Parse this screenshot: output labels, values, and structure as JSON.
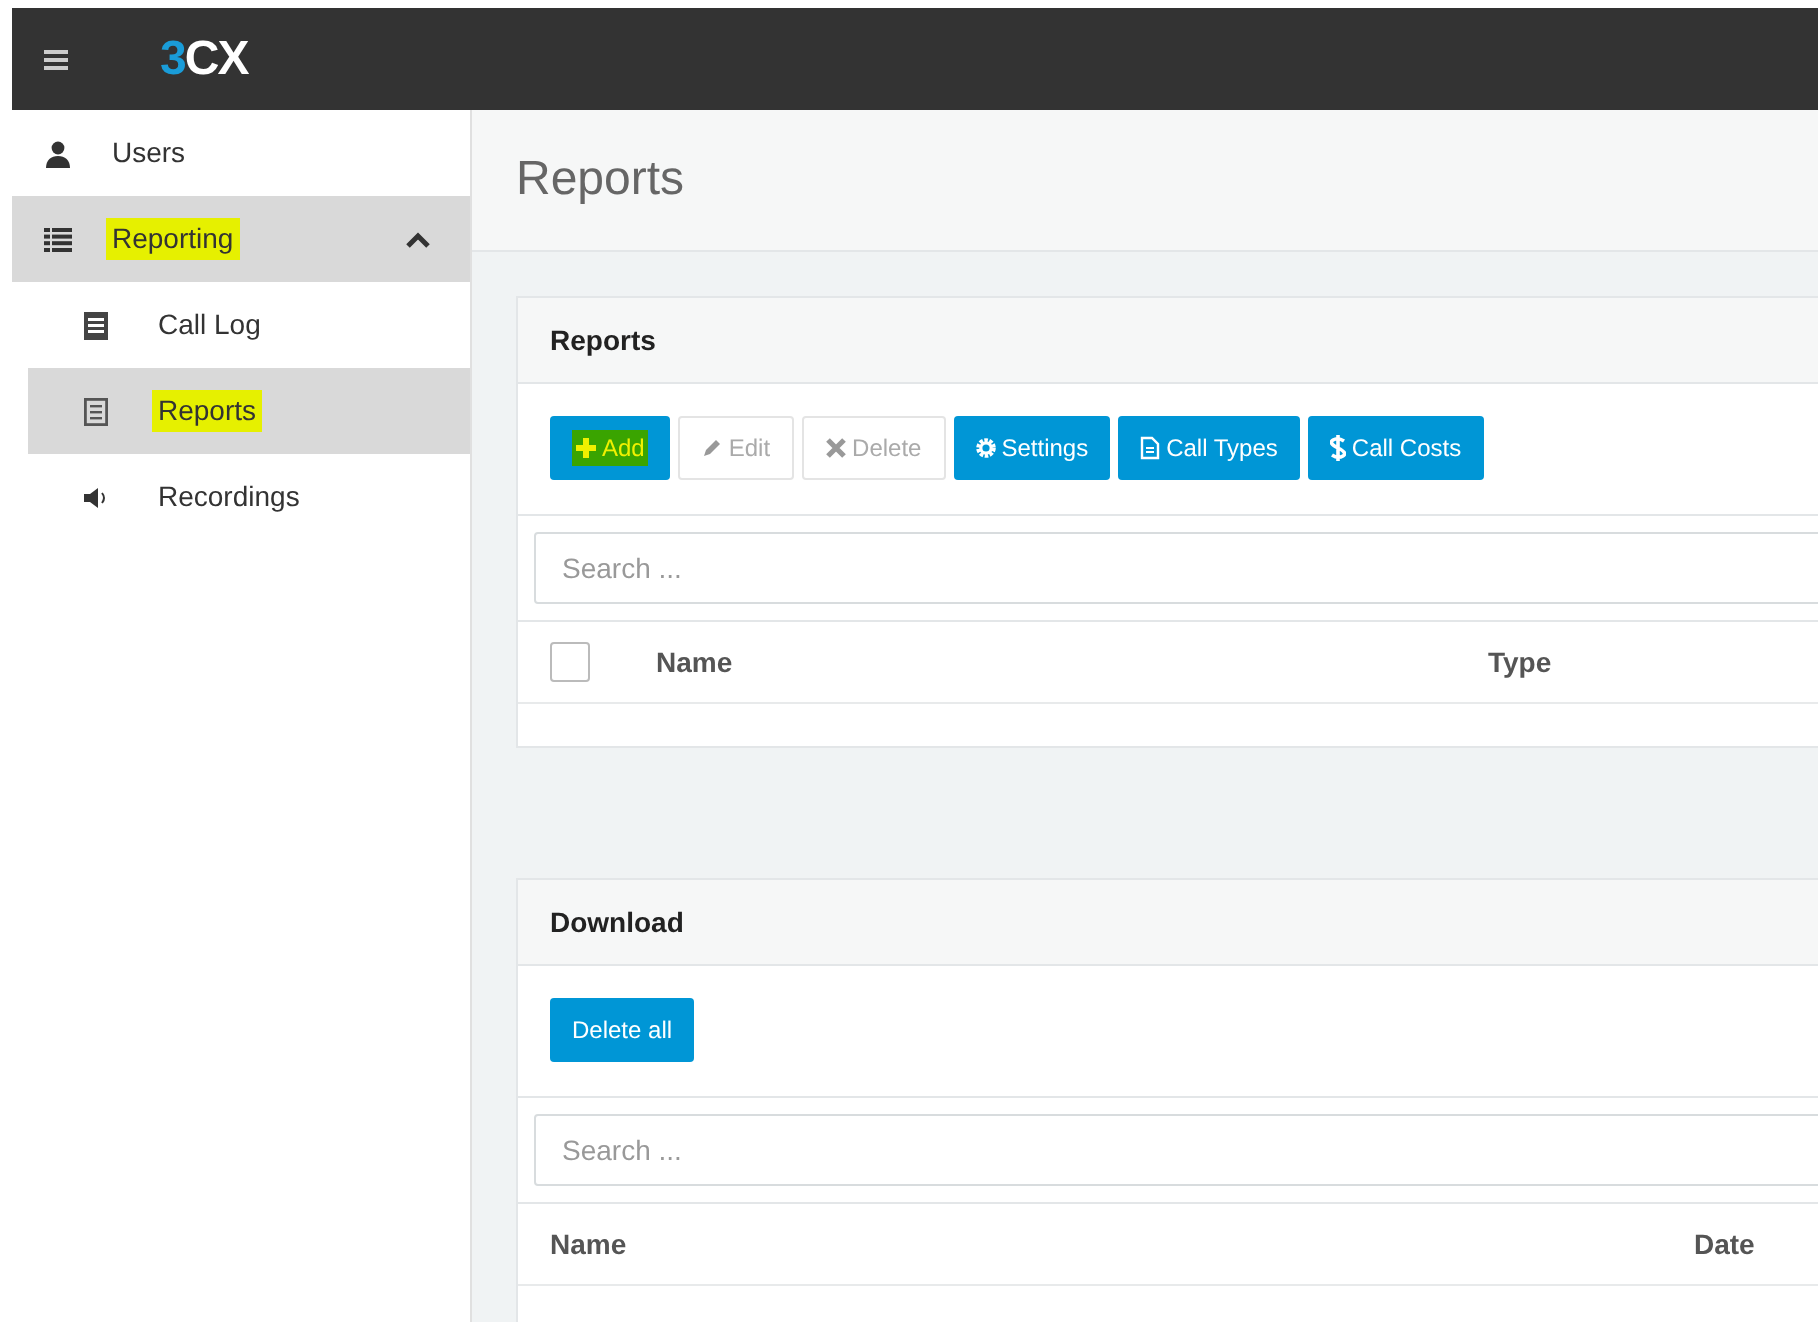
{
  "topbar": {
    "logo": "3CX"
  },
  "sidebar": {
    "items": [
      {
        "label": "Users",
        "kind": "user",
        "selected": false,
        "highlighted": false
      },
      {
        "label": "Reporting",
        "kind": "list",
        "selected": true,
        "highlighted": true,
        "expanded": true,
        "children": [
          {
            "label": "Call Log",
            "kind": "log",
            "selected": false,
            "highlighted": false
          },
          {
            "label": "Reports",
            "kind": "report",
            "selected": true,
            "highlighted": true
          },
          {
            "label": "Recordings",
            "kind": "speaker",
            "selected": false,
            "highlighted": false
          }
        ]
      }
    ]
  },
  "page_title": "Reports",
  "reports_panel": {
    "title": "Reports",
    "buttons": [
      {
        "label": "Add",
        "kind": "plus",
        "disabled": false,
        "highlighted": true
      },
      {
        "label": "Edit",
        "kind": "pencil",
        "disabled": true,
        "highlighted": false
      },
      {
        "label": "Delete",
        "kind": "cross",
        "disabled": true,
        "highlighted": false
      },
      {
        "label": "Settings",
        "kind": "gear",
        "disabled": false,
        "highlighted": false
      },
      {
        "label": "Call Types",
        "kind": "file",
        "disabled": false,
        "highlighted": false
      },
      {
        "label": "Call Costs",
        "kind": "dollar",
        "disabled": false,
        "highlighted": false
      }
    ],
    "search": {
      "placeholder": "Search ..."
    },
    "table": {
      "select_all": {
        "checked": false
      },
      "columns": [
        "Name",
        "Type"
      ]
    }
  },
  "download_panel": {
    "title": "Download",
    "buttons": [
      {
        "label": "Delete all",
        "disabled": false,
        "highlighted": false
      }
    ],
    "search": {
      "placeholder": "Search ..."
    },
    "table": {
      "columns": [
        "Name",
        "Date"
      ]
    }
  }
}
